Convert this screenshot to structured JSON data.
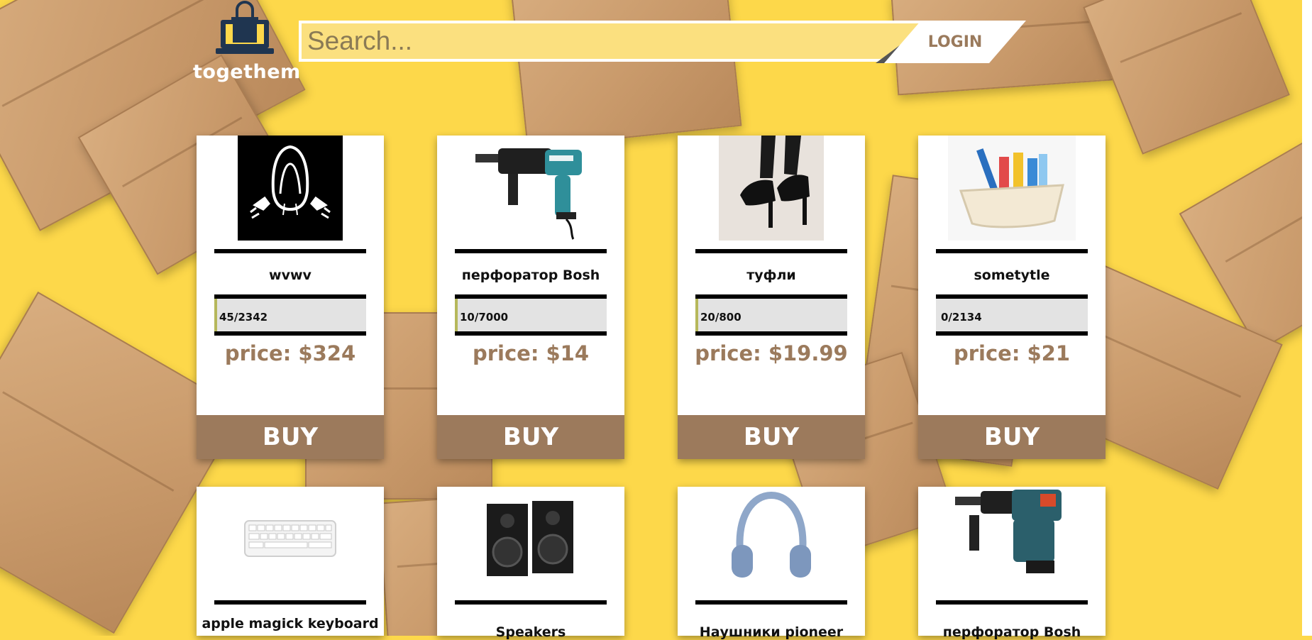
{
  "header": {
    "brand": "togethem",
    "search_placeholder": "Search...",
    "login_label": "LOGIN"
  },
  "products": [
    {
      "name": "wvwv",
      "progress_text": "45/2342",
      "progress_fraction": 0.019,
      "price": "price: $324",
      "buy_label": "BUY",
      "image_icon": "hoodie-figure-icon"
    },
    {
      "name": "перфоратор Bosh",
      "progress_text": "10/7000",
      "progress_fraction": 0.0014,
      "price": "price: $14",
      "buy_label": "BUY",
      "image_icon": "rotary-hammer-icon"
    },
    {
      "name": "туфли",
      "progress_text": "20/800",
      "progress_fraction": 0.025,
      "price": "price: $19.99",
      "buy_label": "BUY",
      "image_icon": "high-heels-icon"
    },
    {
      "name": "sometytle",
      "progress_text": "0/2134",
      "progress_fraction": 0,
      "price": "price: $21",
      "buy_label": "BUY",
      "image_icon": "cleaning-supplies-icon"
    },
    {
      "name": "apple magick keyboard",
      "image_icon": "keyboard-icon"
    },
    {
      "name": "Speakers",
      "image_icon": "speakers-icon"
    },
    {
      "name": "Наушники pioneer",
      "image_icon": "headphones-icon"
    },
    {
      "name": "перфоратор Bosh",
      "image_icon": "rotary-hammer-icon"
    }
  ],
  "colors": {
    "background": "#FDD84A",
    "accent_brown": "#9C7A5C",
    "search_fill": "#FBE07F",
    "logo_navy": "#1F3550"
  }
}
